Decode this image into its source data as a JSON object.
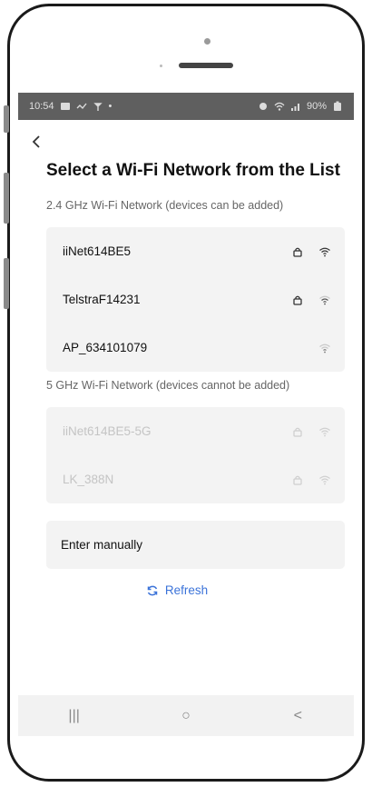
{
  "status_bar": {
    "time": "10:54",
    "battery": "90%"
  },
  "page": {
    "title": "Select a Wi-Fi Network from the List"
  },
  "section_24": {
    "label": "2.4 GHz Wi-Fi Network (devices can be added)",
    "networks": [
      {
        "name": "iiNet614BE5",
        "secured": true
      },
      {
        "name": "TelstraF14231",
        "secured": true
      },
      {
        "name": "AP_634101079",
        "secured": false
      }
    ]
  },
  "section_5": {
    "label": "5 GHz Wi-Fi Network (devices cannot be added)",
    "networks": [
      {
        "name": "iiNet614BE5-5G",
        "secured": true
      },
      {
        "name": "LK_388N",
        "secured": true
      }
    ]
  },
  "manual": {
    "label": "Enter manually"
  },
  "refresh": {
    "label": "Refresh"
  },
  "nav_bar": {
    "recents": "|||",
    "home": "○",
    "back": "<"
  },
  "colors": {
    "accent": "#3b73d9",
    "card_bg": "#f3f3f3",
    "disabled_text": "#c4c4c4"
  }
}
